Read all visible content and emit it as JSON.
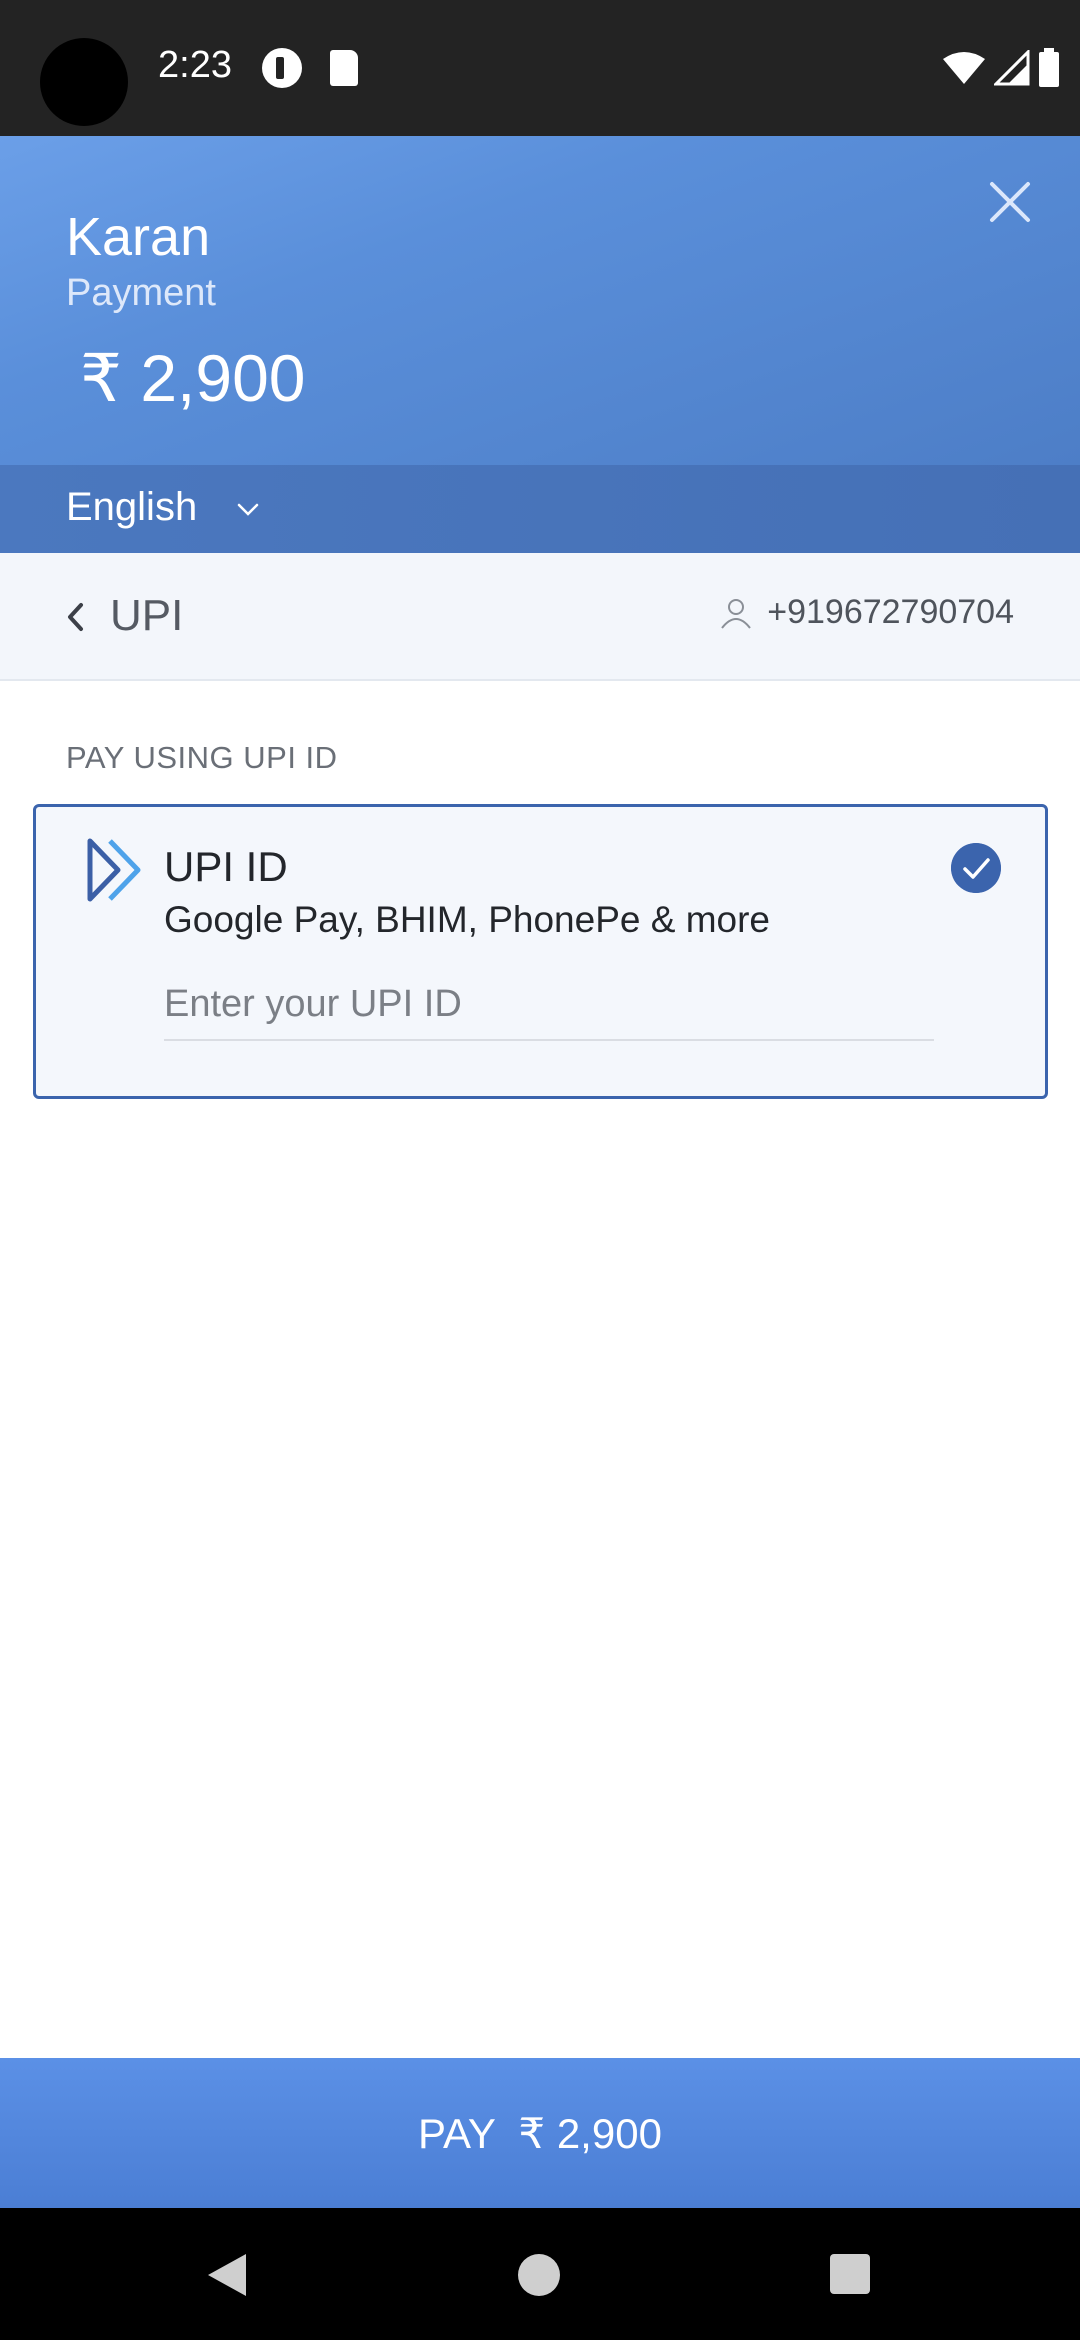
{
  "status_bar": {
    "time": "2:23",
    "icons": [
      "pocket-casts-icon",
      "sd-card-icon",
      "wifi-icon",
      "signal-icon",
      "battery-icon"
    ]
  },
  "header": {
    "merchant_name": "Karan",
    "subtitle": "Payment",
    "amount": "₹ 2,900",
    "language": "English",
    "close_icon": "close-icon"
  },
  "method_bar": {
    "title": "UPI",
    "contact": "+919672790704"
  },
  "section": {
    "label": "PAY USING UPI ID"
  },
  "upi_card": {
    "title": "UPI ID",
    "description": "Google Pay, BHIM, PhonePe & more",
    "input_value": "",
    "input_placeholder": "Enter your UPI ID",
    "selected": true
  },
  "pay_button": {
    "label": "PAY  ₹ 2,900"
  },
  "colors": {
    "status_bar": "#232323",
    "header_light": "#6b9fe8",
    "header_dark": "#4d7ec7",
    "accent": "#3b64ad",
    "pay_button": "#5b90e6"
  }
}
